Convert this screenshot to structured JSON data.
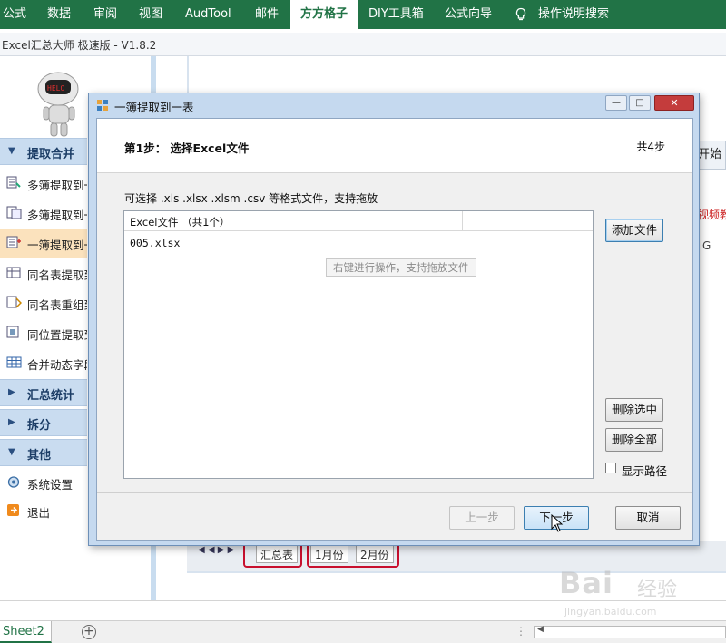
{
  "menubar": {
    "tabs": [
      {
        "label": "公式",
        "active": false
      },
      {
        "label": "数据",
        "active": false
      },
      {
        "label": "审阅",
        "active": false
      },
      {
        "label": "视图",
        "active": false
      },
      {
        "label": "AudTool",
        "active": false
      },
      {
        "label": "邮件",
        "active": false
      },
      {
        "label": "方方格子",
        "active": true
      },
      {
        "label": "DIY工具箱",
        "active": false
      },
      {
        "label": "公式向导",
        "active": false
      }
    ],
    "search_label": "操作说明搜索"
  },
  "app": {
    "title": "Excel汇总大师 极速版 - V1.8.2"
  },
  "sidebar": {
    "sections": [
      {
        "label": "提取合并"
      },
      {
        "label": "汇总统计"
      },
      {
        "label": "拆分"
      },
      {
        "label": "其他"
      }
    ],
    "extract_items": [
      {
        "label": "多簿提取到一表",
        "selected": false
      },
      {
        "label": "多簿提取到一簿",
        "selected": false
      },
      {
        "label": "一簿提取到一表",
        "selected": true
      },
      {
        "label": "同名表提取到一簿",
        "selected": false
      },
      {
        "label": "同名表重组到一簿",
        "selected": false
      },
      {
        "label": "同位置提取到一表",
        "selected": false
      },
      {
        "label": "合并动态字段",
        "selected": false
      }
    ],
    "other_items": [
      {
        "label": "系统设置"
      },
      {
        "label": "退出"
      }
    ]
  },
  "background": {
    "right_button": "开始",
    "right_link": "视频教程",
    "right_col": "G"
  },
  "dialog": {
    "title": "一簿提取到一表",
    "step_title": "第1步： 选择Excel文件",
    "step_total": "共4步",
    "hint": "可选择 .xls  .xlsx  .xlsm .csv 等格式文件，支持拖放",
    "file_list": {
      "header": "Excel文件 （共1个）",
      "files": [
        "005.xlsx"
      ],
      "tip": "右键进行操作，支持拖放文件"
    },
    "buttons": {
      "add_file": "添加文件",
      "delete_selected": "删除选中",
      "delete_all": "删除全部",
      "prev": "上一步",
      "next": "下一步",
      "cancel": "取消"
    },
    "show_path_label": "显示路径",
    "show_path_checked": false
  },
  "inner_sheet_tabs": [
    "汇总表",
    "1月份",
    "2月份"
  ],
  "excel_sheets": {
    "active": "Sheet2"
  },
  "watermark": {
    "brand": "Bai",
    "suffix": "经验",
    "url": "jingyan.baidu.com"
  },
  "colors": {
    "excel_green": "#217346",
    "section_blue": "#c9dcf0",
    "selected_item": "#fbe2bd",
    "highlight_red": "#c8102e"
  }
}
